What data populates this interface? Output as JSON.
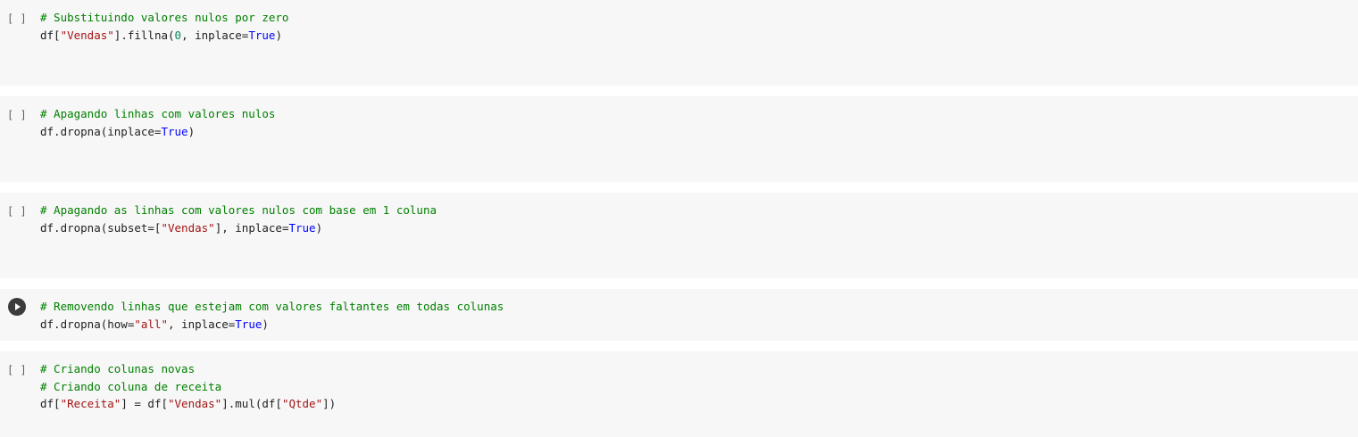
{
  "cells": [
    {
      "gutter": "[ ]",
      "state": "idle",
      "lines": [
        [
          {
            "t": "cm",
            "v": "# Substituindo valores nulos por zero"
          }
        ],
        [
          {
            "t": "",
            "v": "df["
          },
          {
            "t": "st",
            "v": "\"Vendas\""
          },
          {
            "t": "",
            "v": "].fillna("
          },
          {
            "t": "nm",
            "v": "0"
          },
          {
            "t": "",
            "v": ", inplace="
          },
          {
            "t": "kw",
            "v": "True"
          },
          {
            "t": "",
            "v": ")"
          }
        ]
      ]
    },
    {
      "gutter": "[ ]",
      "state": "idle",
      "lines": [
        [
          {
            "t": "cm",
            "v": "# Apagando linhas com valores nulos"
          }
        ],
        [
          {
            "t": "",
            "v": "df.dropna(inplace="
          },
          {
            "t": "kw",
            "v": "True"
          },
          {
            "t": "",
            "v": ")"
          }
        ]
      ]
    },
    {
      "gutter": "[ ]",
      "state": "idle",
      "lines": [
        [
          {
            "t": "cm",
            "v": "# Apagando as linhas com valores nulos com base em 1 coluna"
          }
        ],
        [
          {
            "t": "",
            "v": "df.dropna(subset=["
          },
          {
            "t": "st",
            "v": "\"Vendas\""
          },
          {
            "t": "",
            "v": "], inplace="
          },
          {
            "t": "kw",
            "v": "True"
          },
          {
            "t": "",
            "v": ")"
          }
        ]
      ]
    },
    {
      "gutter": "run",
      "state": "focused",
      "lines": [
        [
          {
            "t": "cm",
            "v": "# Removendo linhas que estejam com valores faltantes em todas colunas"
          }
        ],
        [
          {
            "t": "",
            "v": "df.dropna(how="
          },
          {
            "t": "st",
            "v": "\"all\""
          },
          {
            "t": "",
            "v": ", inplace="
          },
          {
            "t": "kw",
            "v": "True"
          },
          {
            "t": "",
            "v": ")"
          }
        ]
      ]
    },
    {
      "gutter": "[ ]",
      "state": "idle",
      "lines": [
        [
          {
            "t": "cm",
            "v": "# Criando colunas novas"
          }
        ],
        [
          {
            "t": "cm",
            "v": "# Criando coluna de receita"
          }
        ],
        [
          {
            "t": "",
            "v": "df["
          },
          {
            "t": "st",
            "v": "\"Receita\""
          },
          {
            "t": "",
            "v": "] = df["
          },
          {
            "t": "st",
            "v": "\"Vendas\""
          },
          {
            "t": "",
            "v": "].mul(df["
          },
          {
            "t": "st",
            "v": "\"Qtde\""
          },
          {
            "t": "",
            "v": "])"
          }
        ]
      ]
    }
  ]
}
